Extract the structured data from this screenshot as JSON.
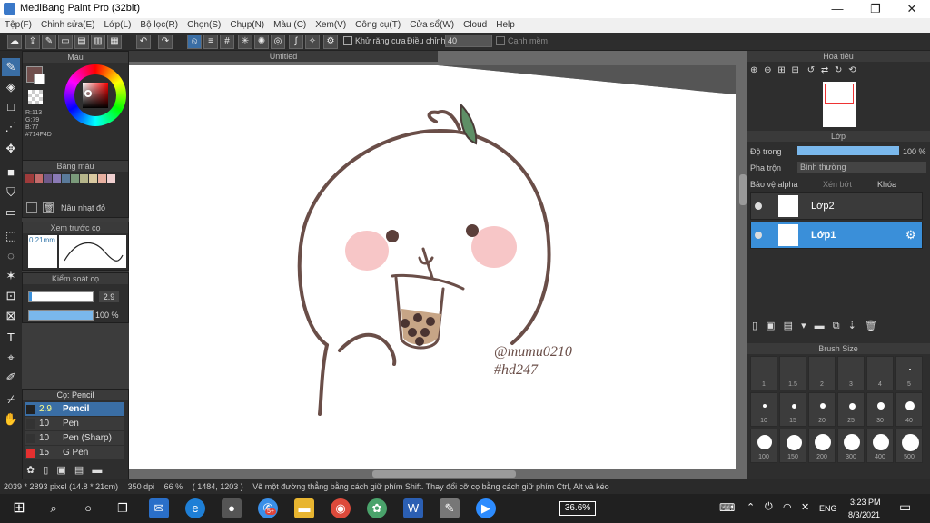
{
  "app": {
    "title": "MediBang Paint Pro (32bit)"
  },
  "menu": [
    "Tệp(F)",
    "Chỉnh sửa(E)",
    "Lớp(L)",
    "Bộ lọc(R)",
    "Chọn(S)",
    "Chụp(N)",
    "Màu (C)",
    "Xem(V)",
    "Công cụ(T)",
    "Cửa sổ(W)",
    "Cloud",
    "Help"
  ],
  "toolbar": {
    "antialias": "Khử răng cưa",
    "adjust": "Điều chỉnh",
    "adjust_value": "40",
    "edge": "Cạnh mềm"
  },
  "color_panel": {
    "title": "Màu",
    "r": "R:113",
    "g": "G:79",
    "b": "B:77",
    "hex": "#714F4D",
    "fg": "#714F4D"
  },
  "palette": {
    "title": "Bảng màu",
    "selected": "Nâu nhạt đỏ",
    "swatches": [
      "#9e3b3b",
      "#c46b6b",
      "#6e5a8a",
      "#8a7ab5",
      "#5a7a9a",
      "#7a9a7a",
      "#b5b58a",
      "#d9c9a0",
      "#e8b0a0",
      "#f0d0d0"
    ]
  },
  "preview": {
    "title": "Xem trước cọ",
    "size": "0.21mm"
  },
  "brush_ctrl": {
    "title": "Kiểm soát cọ",
    "size": "2.9",
    "opacity": "100 %"
  },
  "brush_list": {
    "title": "Cọ: Pencil",
    "items": [
      {
        "size": "2.9",
        "name": "Pencil",
        "color": "#3a6ea5"
      },
      {
        "size": "10",
        "name": "Pen",
        "color": "#333"
      },
      {
        "size": "10",
        "name": "Pen (Sharp)",
        "color": "#333"
      },
      {
        "size": "15",
        "name": "G Pen",
        "color": "#e53030"
      }
    ]
  },
  "canvas": {
    "tab": "Untitled",
    "sig1": "@mumu0210",
    "sig2": "#hd247"
  },
  "navigator": {
    "title": "Hoa tiêu"
  },
  "layers": {
    "title": "Lớp",
    "opacity_label": "Độ trong",
    "opacity": "100 %",
    "blend_label": "Pha trộn",
    "blend": "Bình thường",
    "protect": "Bảo vệ alpha",
    "clip": "Xén bớt",
    "lock": "Khóa",
    "items": [
      {
        "name": "Lớp2",
        "active": false
      },
      {
        "name": "Lớp1",
        "active": true
      }
    ]
  },
  "brush_size": {
    "title": "Brush Size",
    "rows": [
      [
        "1",
        "1.5",
        "2",
        "3",
        "4",
        "5"
      ],
      [
        "10",
        "15",
        "20",
        "25",
        "30",
        "40"
      ],
      [
        "100",
        "150",
        "200",
        "300",
        "400",
        "500"
      ]
    ]
  },
  "status": {
    "size": "2039 * 2893 pixel",
    "mm": "(14.8 * 21cm)",
    "dpi": "350 dpi",
    "zoom": "66 %",
    "coords": "( 1484, 1203 )",
    "hint": "Vẽ một đường thẳng bằng cách giữ phím Shift. Thay đổi cỡ cọ bằng cách giữ phím Ctrl, Alt và kéo"
  },
  "taskbar": {
    "battery": "36.6%",
    "lang": "ENG",
    "time": "3:23 PM",
    "date": "8/3/2021",
    "badge": "5+"
  }
}
